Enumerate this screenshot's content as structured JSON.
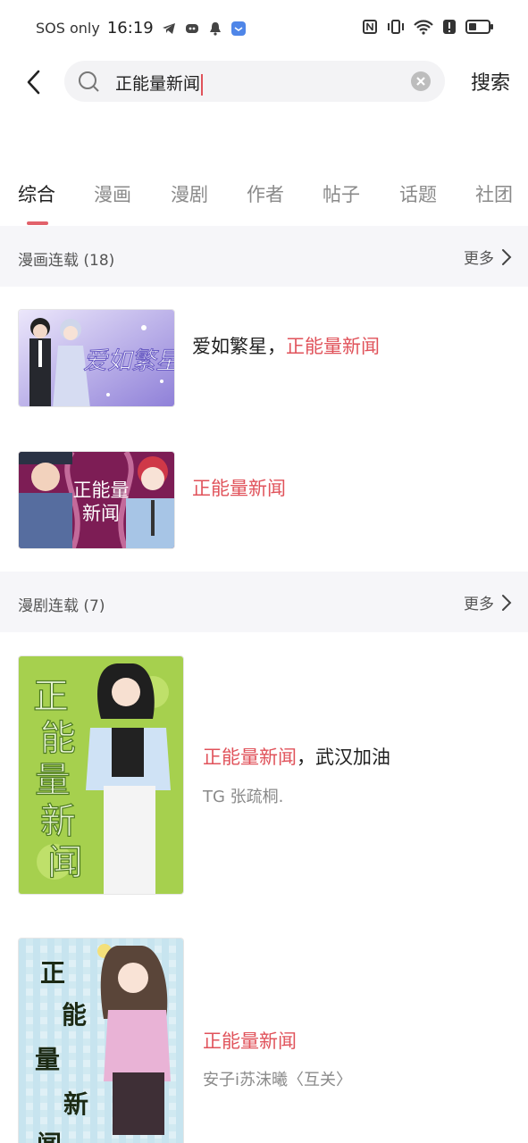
{
  "status_bar": {
    "carrier": "SOS only",
    "time": "16:19",
    "icons_left": [
      "telegram-icon",
      "discord-icon",
      "bell-icon",
      "app-icon"
    ],
    "icons_right": [
      "nfc-icon",
      "vibrate-icon",
      "wifi-icon",
      "alert-icon",
      "battery-icon"
    ]
  },
  "search": {
    "query": "正能量新闻",
    "submit_label": "搜索"
  },
  "tabs": [
    "综合",
    "漫画",
    "漫剧",
    "作者",
    "帖子",
    "话题",
    "社团"
  ],
  "active_tab": 0,
  "manga_section": {
    "title": "漫画连载 (18)",
    "more_label": "更多",
    "items": [
      {
        "title_plain": "爱如繁星，",
        "title_highlight": "正能量新闻",
        "cover_text": "爱如繁星"
      },
      {
        "title_plain": "",
        "title_highlight": "正能量新闻",
        "cover_text": "正能量新闻"
      }
    ]
  },
  "drama_section": {
    "title": "漫剧连载 (7)",
    "more_label": "更多",
    "items": [
      {
        "title_highlight": "正能量新闻",
        "title_plain": "，武汉加油",
        "author": "TG 张疏桐.",
        "cover_text": "正能量新闻"
      },
      {
        "title_highlight": "正能量新闻",
        "title_plain": "",
        "author": "安子i苏沫曦〈互关〉",
        "cover_text": "正能量新闻"
      }
    ]
  },
  "colors": {
    "accent": "#e0525a",
    "section_bg": "#f6f6f9"
  }
}
